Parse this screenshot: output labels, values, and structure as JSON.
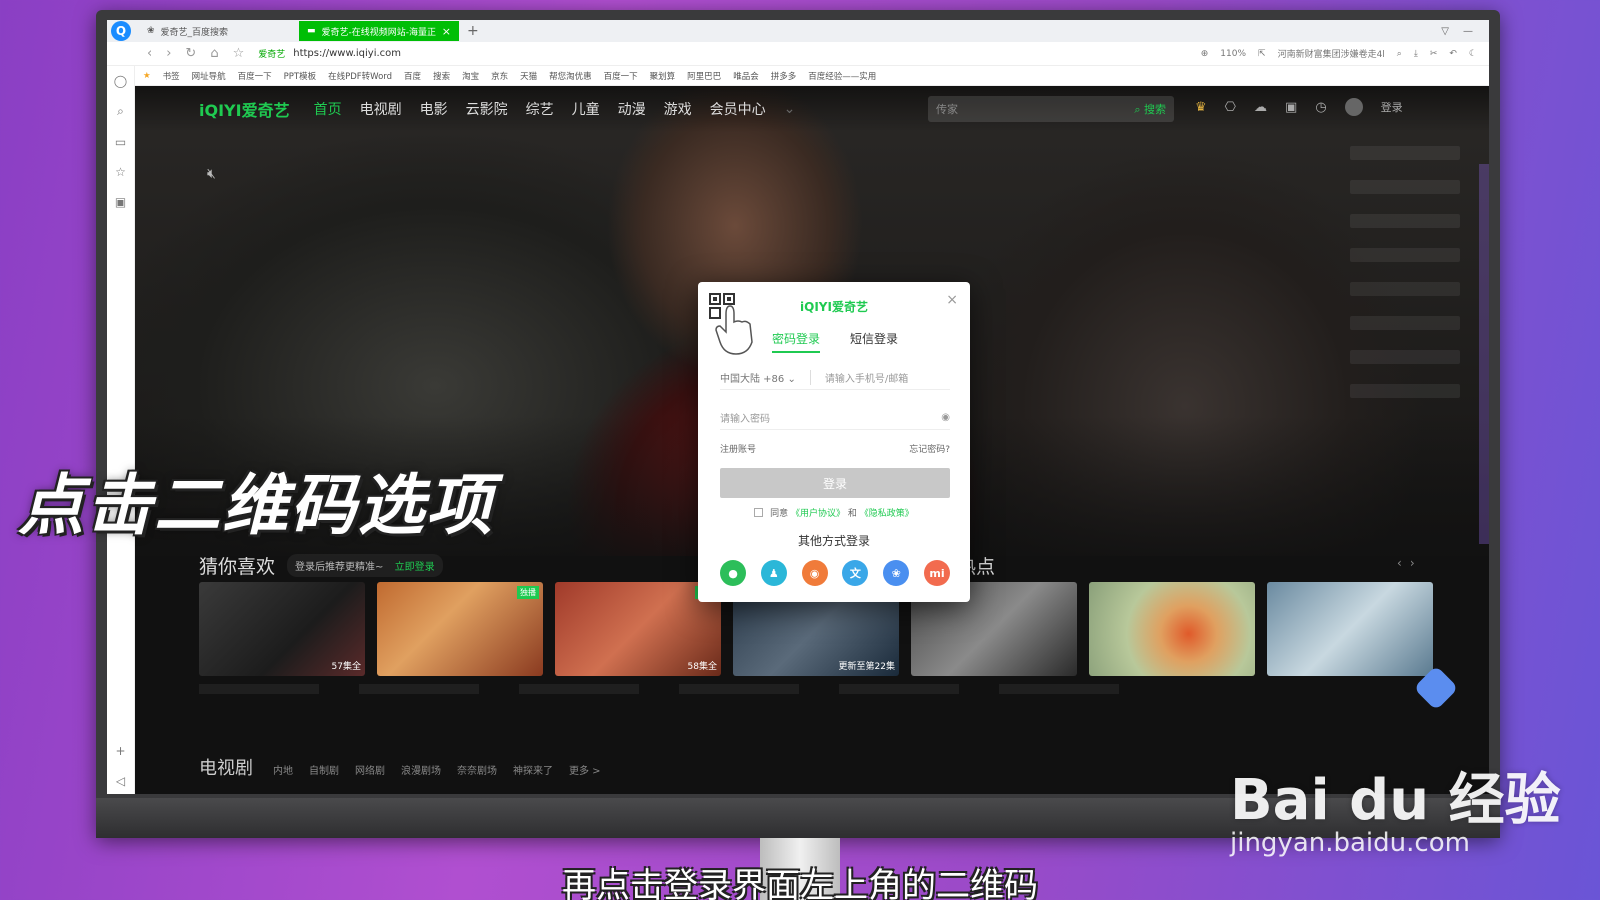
{
  "browser": {
    "tabs": [
      {
        "label": "爱奇艺_百度搜索",
        "active": false
      },
      {
        "label": "爱奇艺-在线视频网站-海量正版高清",
        "active": true
      }
    ],
    "new_tab": "+",
    "site_name": "爱奇艺",
    "url": "https://www.iqiyi.com",
    "zoom": "110%",
    "news_ticker": "河南新财富集团涉嫌卷走4l",
    "bookmarks": [
      "书签",
      "网址导航",
      "百度一下",
      "PPT模板",
      "在线PDF转Word",
      "百度",
      "搜索",
      "淘宝",
      "京东",
      "天猫",
      "帮您淘优惠",
      "百度一下",
      "聚划算",
      "阿里巴巴",
      "唯品会",
      "拼多多",
      "百度经验——实用"
    ]
  },
  "site": {
    "logo": "iQIYI爱奇艺",
    "nav": [
      "首页",
      "电视剧",
      "电影",
      "云影院",
      "综艺",
      "儿童",
      "动漫",
      "游戏",
      "会员中心"
    ],
    "search_placeholder": "传家",
    "search_button": "搜索",
    "login_label": "登录",
    "rec_title": "猜你喜欢",
    "rec_hint": "登录后推荐更精准~",
    "rec_hint_link": "立即登录",
    "hot_title": "热点",
    "thumbs": [
      {
        "caption": "57集全",
        "badge": ""
      },
      {
        "caption": "",
        "badge": "独播"
      },
      {
        "caption": "58集全",
        "badge": "独播"
      },
      {
        "caption": "更新至第22集",
        "badge": ""
      },
      {
        "caption": "",
        "badge": ""
      },
      {
        "caption": "",
        "badge": ""
      },
      {
        "caption": "",
        "badge": ""
      }
    ],
    "tv_title": "电视剧",
    "tv_tags": [
      "内地",
      "自制剧",
      "网络剧",
      "浪漫剧场",
      "奈奈剧场",
      "神探来了",
      "更多 >"
    ]
  },
  "login_modal": {
    "logo": "iQIYI爱奇艺",
    "tab_password": "密码登录",
    "tab_sms": "短信登录",
    "country": "中国大陆 +86",
    "phone_placeholder": "请输入手机号/邮箱",
    "password_placeholder": "请输入密码",
    "register": "注册账号",
    "forgot": "忘记密码?",
    "login_button": "登录",
    "agree_prefix": "同意",
    "user_agreement": "《用户协议》",
    "and": "和",
    "privacy": "《隐私政策》",
    "other_login": "其他方式登录",
    "socials": [
      {
        "name": "wechat",
        "color": "#2cbe5a",
        "glyph": "微"
      },
      {
        "name": "qq",
        "color": "#2bb7d8",
        "glyph": "Q"
      },
      {
        "name": "weibo",
        "color": "#f07b3a",
        "glyph": "微"
      },
      {
        "name": "baidu",
        "color": "#3aa7e8",
        "glyph": "文"
      },
      {
        "name": "paw",
        "color": "#4a8ff0",
        "glyph": "百"
      },
      {
        "name": "xiaomi",
        "color": "#f26b4f",
        "glyph": "mi"
      }
    ]
  },
  "overlay": {
    "title": "点击二维码选项",
    "subtitle": "再点击登录界面左上角的二维码",
    "watermark": "Bai du 经验",
    "watermark_url": "jingyan.baidu.com"
  },
  "colors": {
    "accent": "#1fca51",
    "tab_active": "#00be06"
  }
}
